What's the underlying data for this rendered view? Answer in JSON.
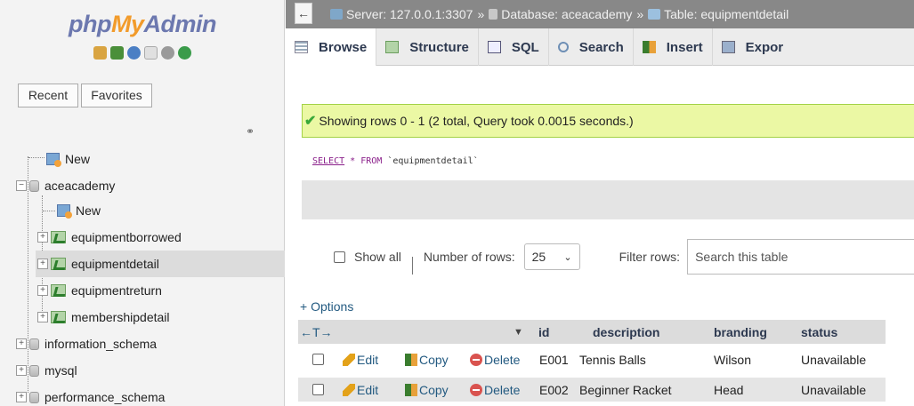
{
  "sidebar": {
    "logo": {
      "php": "php",
      "my": "My",
      "admin": "Admin"
    },
    "tool_icons": [
      {
        "name": "home-icon",
        "color": "#d9a441"
      },
      {
        "name": "logout-icon",
        "color": "#4a8f3a"
      },
      {
        "name": "help-icon",
        "color": "#4b7fc4"
      },
      {
        "name": "docs-icon",
        "color": "#bfbfbf"
      },
      {
        "name": "settings-icon",
        "color": "#9a9a9a"
      },
      {
        "name": "reload-icon",
        "color": "#3a9b4a"
      }
    ],
    "recent_label": "Recent",
    "favorites_label": "Favorites",
    "tree": [
      {
        "label": "New",
        "kind": "new"
      },
      {
        "label": "aceacademy",
        "kind": "db"
      },
      {
        "label": "New",
        "kind": "new"
      },
      {
        "label": "equipmentborrowed",
        "kind": "table"
      },
      {
        "label": "equipmentdetail",
        "kind": "table"
      },
      {
        "label": "equipmentreturn",
        "kind": "table"
      },
      {
        "label": "membershipdetail",
        "kind": "table"
      },
      {
        "label": "information_schema",
        "kind": "db"
      },
      {
        "label": "mysql",
        "kind": "db"
      },
      {
        "label": "performance_schema",
        "kind": "db"
      }
    ]
  },
  "breadcrumb": {
    "server": "Server: 127.0.0.1:3307",
    "database": "Database: aceacademy",
    "table": "Table: equipmentdetail",
    "separator": "»"
  },
  "tabs": [
    {
      "label": "Browse",
      "icon": "browse-icon"
    },
    {
      "label": "Structure",
      "icon": "structure-icon"
    },
    {
      "label": "SQL",
      "icon": "sql-icon"
    },
    {
      "label": "Search",
      "icon": "search-icon"
    },
    {
      "label": "Insert",
      "icon": "insert-icon"
    },
    {
      "label": "Expor",
      "icon": "export-icon"
    }
  ],
  "message": "Showing rows 0 - 1 (2 total, Query took 0.0015 seconds.)",
  "sql": {
    "select": "SELECT",
    "star": "*",
    "from": "FROM",
    "table": "`equipmentdetail`"
  },
  "controls": {
    "show_all": "Show all",
    "rows_label": "Number of rows:",
    "rows_value": "25",
    "filter_label": "Filter rows:",
    "filter_placeholder": "Search this table"
  },
  "options_link": "+ Options",
  "table": {
    "columns": [
      "id",
      "description",
      "branding",
      "status"
    ],
    "rows": [
      [
        "E001",
        "Tennis Balls",
        "Wilson",
        "Unavailable"
      ],
      [
        "E002",
        "Beginner Racket",
        "Head",
        "Unavailable"
      ]
    ],
    "actions": {
      "edit": "Edit",
      "copy": "Copy",
      "delete": "Delete"
    },
    "nav_arrows": "←T→"
  },
  "colors": {
    "success_bg": "#ebf8a4",
    "topbar": "#888888",
    "link": "#235a81"
  }
}
